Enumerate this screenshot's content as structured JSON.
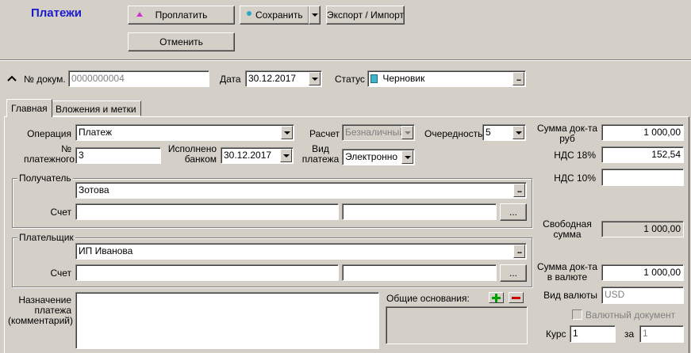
{
  "header": {
    "title": "Платежи",
    "pay_label": "Проплатить",
    "save_label": "Сохранить",
    "export_label": "Экспорт / Импорт",
    "cancel_label": "Отменить"
  },
  "doc": {
    "number_label": "№ докум.",
    "number_value": "0000000004",
    "date_label": "Дата",
    "date_value": "30.12.2017",
    "status_label": "Статус",
    "status_value": "Черновик"
  },
  "tabs": [
    {
      "label": "Главная"
    },
    {
      "label": "Вложения и метки"
    }
  ],
  "main": {
    "operation_label": "Операция",
    "operation_value": "Платеж",
    "calc_label": "Расчет",
    "calc_value": "Безналичный",
    "priority_label": "Очередность",
    "priority_value": "5",
    "payment_no_label_1": "№",
    "payment_no_label_2": "платежного",
    "payment_no_value": "3",
    "executed_label_1": "Исполнено",
    "executed_label_2": "банком",
    "executed_value": "30.12.2017",
    "payment_kind_label_1": "Вид",
    "payment_kind_label_2": "платежа",
    "payment_kind_value": "Электронно"
  },
  "recipient": {
    "title": "Получатель",
    "name": "Зотова",
    "account_label": "Счет",
    "account_value": "",
    "account_value2": "",
    "browse_label": "..."
  },
  "payer": {
    "title": "Плательщик",
    "name": "ИП Иванова",
    "account_label": "Счет",
    "account_value": "",
    "account_value2": "",
    "browse_label": "..."
  },
  "purpose": {
    "label_1": "Назначение",
    "label_2": "платежа",
    "label_3": "(комментарий)",
    "value": "",
    "common_grounds_label": "Общие основания:"
  },
  "sums": {
    "doc_sum_label_1": "Сумма док-та",
    "doc_sum_label_2": "руб",
    "doc_sum_value": "1 000,00",
    "vat18_label": "НДС 18%",
    "vat18_value": "152,54",
    "vat10_label": "НДС 10%",
    "vat10_value": "",
    "free_sum_label_1": "Свободная",
    "free_sum_label_2": "сумма",
    "free_sum_value": "1 000,00",
    "currency_sum_label_1": "Сумма док-та",
    "currency_sum_label_2": "в валюте",
    "currency_sum_value": "1 000,00",
    "currency_kind_label": "Вид валюты",
    "currency_kind_value": "USD",
    "currency_doc_label": "Валютный документ",
    "rate_label": "Курс",
    "rate_value": "1",
    "for_label": "за",
    "for_value": "1"
  },
  "colors": {
    "title": "#1a1acc",
    "pay_icon": "#cc33cc",
    "add_icon": "#00a000",
    "remove_icon": "#cc0000"
  }
}
